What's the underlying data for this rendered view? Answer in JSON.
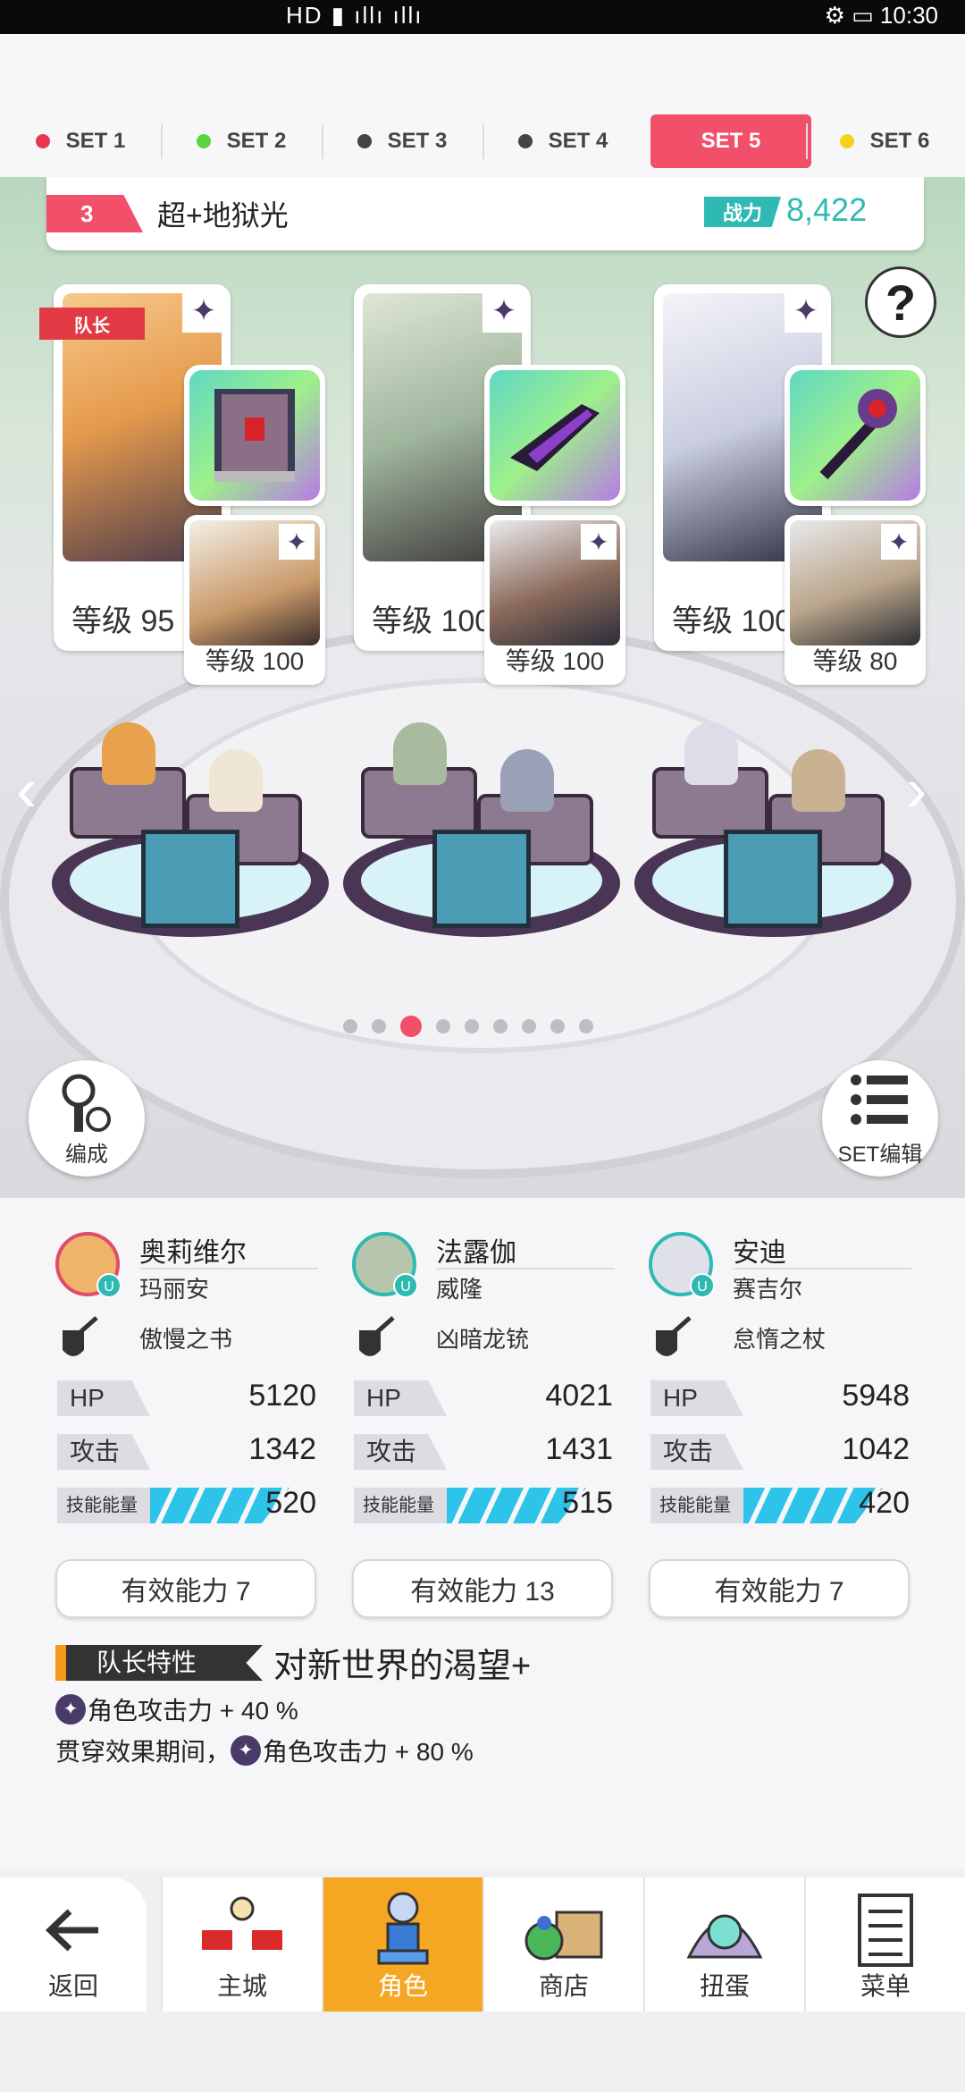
{
  "set_tabs": [
    {
      "label": "SET 1",
      "dot": "#e8384f"
    },
    {
      "label": "SET 2",
      "dot": "#5ad43c"
    },
    {
      "label": "SET 3",
      "dot": "#444444"
    },
    {
      "label": "SET 4",
      "dot": "#444444"
    },
    {
      "label": "SET 5",
      "dot": "#ffffff",
      "active": true
    },
    {
      "label": "SET 6",
      "dot": "#f5d31c"
    }
  ],
  "team": {
    "number": "3",
    "name": "超+地狱光",
    "power_label": "战力",
    "power_value": "8,422"
  },
  "leader_tag": "队长",
  "cards": [
    {
      "level": "等级 95",
      "sub_level": "等级 100"
    },
    {
      "level": "等级 100",
      "sub_level": "等级 100"
    },
    {
      "level": "等级 100",
      "sub_level": "等级 80"
    }
  ],
  "buttons": {
    "formation": "编成",
    "set_edit": "SET编辑",
    "help": "?"
  },
  "characters": [
    {
      "name": "奥莉维尔",
      "sub": "玛丽安",
      "weapon": "傲慢之书",
      "hp": "5120",
      "atk": "1342",
      "energy": "520",
      "effective": "有效能力 7"
    },
    {
      "name": "法露伽",
      "sub": "威隆",
      "weapon": "凶暗龙铳",
      "hp": "4021",
      "atk": "1431",
      "energy": "515",
      "effective": "有效能力 13"
    },
    {
      "name": "安迪",
      "sub": "赛吉尔",
      "weapon": "怠惰之杖",
      "hp": "5948",
      "atk": "1042",
      "energy": "420",
      "effective": "有效能力 7"
    }
  ],
  "stat_labels": {
    "hp": "HP",
    "atk": "攻击",
    "energy": "技能能量"
  },
  "leader_trait": {
    "tag": "队长特性",
    "title": "对新世界的渴望+",
    "line1": "角色攻击力 + 40 %",
    "line2_prefix": "贯穿效果期间，",
    "line2": "角色攻击力 + 80 %"
  },
  "nav": {
    "back": "返回",
    "home": "主城",
    "character": "角色",
    "shop": "商店",
    "gacha": "扭蛋",
    "menu": "菜单"
  }
}
